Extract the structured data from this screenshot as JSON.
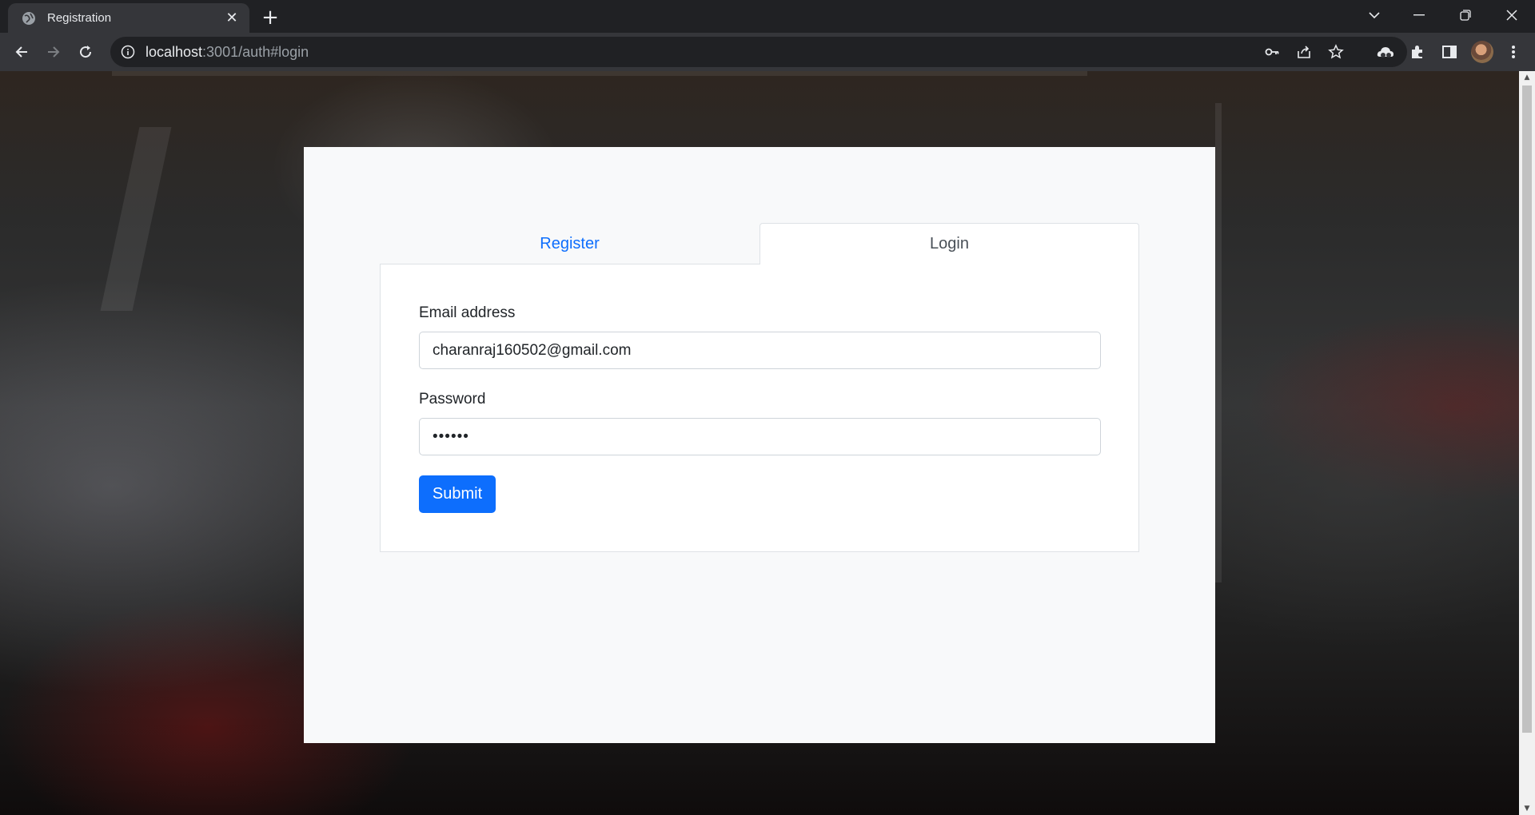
{
  "browser": {
    "tab_title": "Registration",
    "tab_close": "✕",
    "new_tab": "+",
    "url_host": "localhost",
    "url_rest": ":3001/auth#login"
  },
  "auth": {
    "tabs": [
      {
        "label": "Register",
        "active": false
      },
      {
        "label": "Login",
        "active": true
      }
    ],
    "email_label": "Email address",
    "email_value": "charanraj160502@gmail.com",
    "password_label": "Password",
    "password_value": "••••••",
    "submit_label": "Submit"
  },
  "colors": {
    "primary": "#0d6efd",
    "card_bg": "#f8f9fa"
  }
}
